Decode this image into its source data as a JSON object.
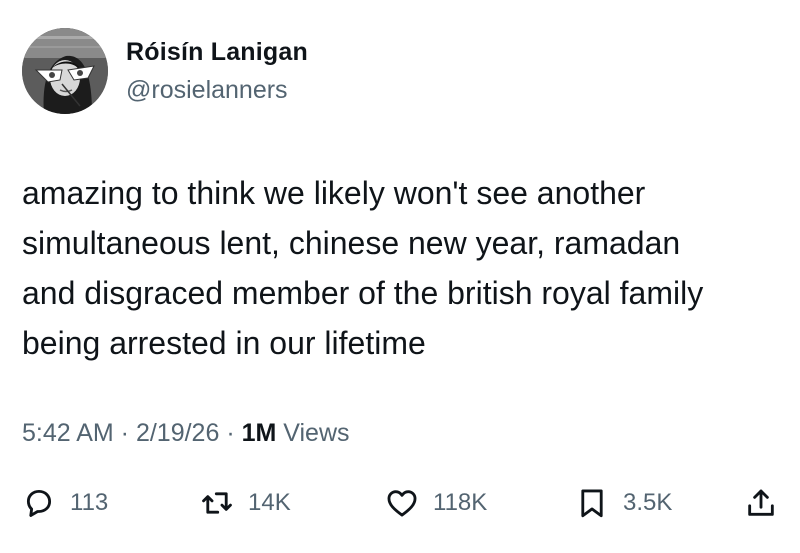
{
  "author": {
    "display_name": "Róisín Lanigan",
    "handle": "@rosielanners"
  },
  "tweet": {
    "lines": [
      "amazing to think we likely won't see another",
      "simultaneous lent, chinese new year, ramadan",
      "and disgraced member of the british royal family",
      "being arrested in our lifetime"
    ]
  },
  "meta": {
    "time": "5:42 AM",
    "separator1": " · ",
    "date": "2/19/26",
    "separator2": " · ",
    "views_count": "1M",
    "views_label": " Views"
  },
  "actions": {
    "reply": {
      "icon": "reply-icon",
      "count": "113"
    },
    "retweet": {
      "icon": "retweet-icon",
      "count": "14K"
    },
    "like": {
      "icon": "heart-icon",
      "count": "118K"
    },
    "bookmark": {
      "icon": "bookmark-icon",
      "count": "3.5K"
    },
    "share": {
      "icon": "share-icon"
    }
  },
  "colors": {
    "text": "#0f1419",
    "secondary": "#536471",
    "background": "#ffffff"
  }
}
